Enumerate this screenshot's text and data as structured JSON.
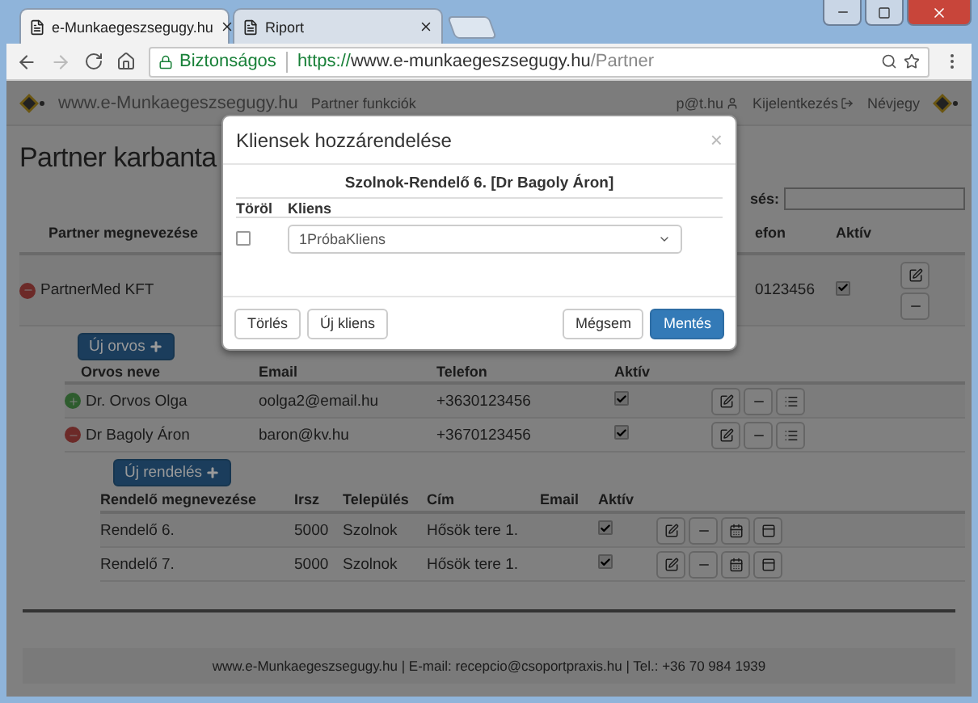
{
  "browser": {
    "tabs": [
      {
        "title": "e-Munkaegeszsegugy.hu",
        "selected": true
      },
      {
        "title": "Riport",
        "selected": false
      }
    ],
    "secure_label": "Biztonságos",
    "url": {
      "scheme": "https://",
      "host": "www.e-munkaegeszsegugy.hu",
      "path": "/Partner"
    }
  },
  "navbar": {
    "brand": "www.e-Munkaegeszsegugy.hu",
    "menu": "Partner funkciók",
    "user": "p@t.hu",
    "logout": "Kijelentkezés",
    "about": "Névjegy"
  },
  "page": {
    "title": "Partner karbanta",
    "search_label": "sés:"
  },
  "partner_table": {
    "columns": [
      "Partner megnevezése",
      "efon",
      "Aktív"
    ],
    "rows": [
      {
        "name": "PartnerMed KFT",
        "phone": "0123456",
        "active": true,
        "expanded": true
      }
    ]
  },
  "doctors": {
    "add_button": "Új orvos",
    "columns": [
      "Orvos neve",
      "Email",
      "Telefon",
      "Aktív"
    ],
    "rows": [
      {
        "name": "Dr. Orvos Olga",
        "email": "oolga2@email.hu",
        "phone": "+3630123456",
        "active": true,
        "expanded": false
      },
      {
        "name": "Dr Bagoly Áron",
        "email": "baron@kv.hu",
        "phone": "+3670123456",
        "active": true,
        "expanded": true
      }
    ]
  },
  "offices": {
    "add_button": "Új rendelés",
    "columns": [
      "Rendelő megnevezése",
      "Irsz",
      "Település",
      "Cím",
      "Email",
      "Aktív"
    ],
    "rows": [
      {
        "name": "Rendelő 6.",
        "zip": "5000",
        "city": "Szolnok",
        "address": "Hősök tere 1.",
        "active": true
      },
      {
        "name": "Rendelő 7.",
        "zip": "5000",
        "city": "Szolnok",
        "address": "Hősök tere 1.",
        "active": true
      }
    ]
  },
  "footer": "www.e-Munkaegeszsegugy.hu | E-mail: recepcio@csoportpraxis.hu | Tel.: +36 70 984 1939",
  "modal": {
    "title": "Kliensek hozzárendelése",
    "close": "×",
    "subtitle": "Szolnok-Rendelő 6. [Dr Bagoly Áron]",
    "columns": [
      "Töröl",
      "Kliens"
    ],
    "rows": [
      {
        "delete": false,
        "client": "1PróbaKliens"
      }
    ],
    "left_buttons": [
      "Törlés",
      "Új kliens"
    ],
    "cancel": "Mégsem",
    "save": "Mentés"
  }
}
